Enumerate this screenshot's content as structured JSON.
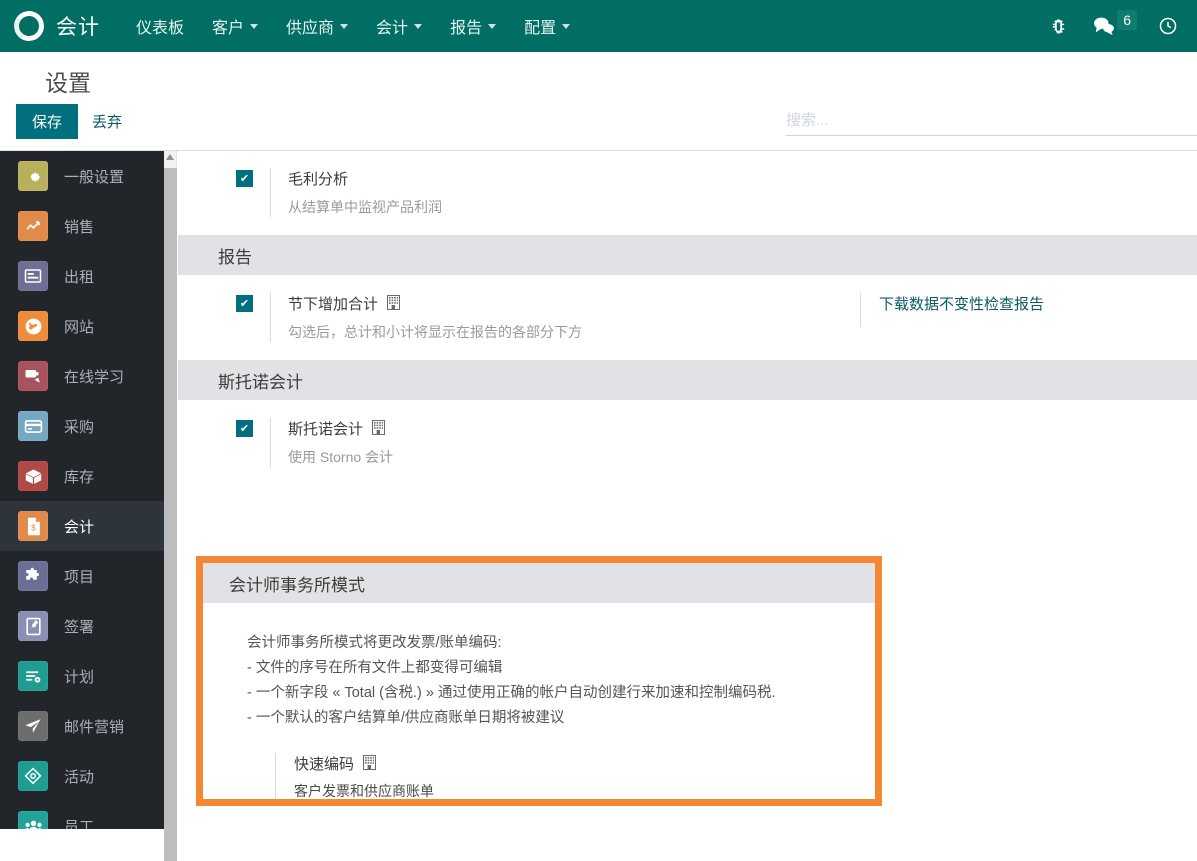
{
  "topbar": {
    "logo_icon": "odoo-o-logo",
    "brand": "会计",
    "menu": [
      {
        "label": "仪表板",
        "has_caret": false
      },
      {
        "label": "客户",
        "has_caret": true
      },
      {
        "label": "供应商",
        "has_caret": true
      },
      {
        "label": "会计",
        "has_caret": true
      },
      {
        "label": "报告",
        "has_caret": true
      },
      {
        "label": "配置",
        "has_caret": true
      }
    ],
    "icons": {
      "debug": "bug-icon",
      "messages": "chat-bubble-icon",
      "messages_count": "6",
      "activity": "clock-icon"
    },
    "background": "#006e62"
  },
  "controlpanel": {
    "title": "设置",
    "save_label": "保存",
    "discard_label": "丢弃",
    "save_color": "#00707f"
  },
  "search": {
    "placeholder": "搜索...",
    "value": ""
  },
  "sidebar": {
    "items": [
      {
        "label": "一般设置",
        "icon": "gear-icon",
        "glyph": "⚙",
        "color": "#b9b05e",
        "active": false
      },
      {
        "label": "销售",
        "icon": "chart-line-icon",
        "glyph": "↗",
        "color": "#e08b4a",
        "active": false
      },
      {
        "label": "出租",
        "icon": "rental-card-icon",
        "glyph": "▤",
        "color": "#6f6f93",
        "active": false
      },
      {
        "label": "网站",
        "icon": "globe-icon",
        "glyph": "ἱ0",
        "color": "#ef8c3a",
        "active": false
      },
      {
        "label": "在线学习",
        "icon": "elearning-icon",
        "glyph": "▶",
        "color": "#a8525c",
        "active": false
      },
      {
        "label": "采购",
        "icon": "credit-card-icon",
        "glyph": "▭",
        "color": "#76a8c2",
        "active": false
      },
      {
        "label": "库存",
        "icon": "box-icon",
        "glyph": "▦",
        "color": "#b04a46",
        "active": false
      },
      {
        "label": "会计",
        "icon": "invoice-icon",
        "glyph": "$",
        "color": "#e08b4a",
        "active": true
      },
      {
        "label": "项目",
        "icon": "puzzle-icon",
        "glyph": "❖",
        "color": "#6b6f96",
        "active": false
      },
      {
        "label": "签署",
        "icon": "signature-icon",
        "glyph": "✎",
        "color": "#8b8fb3",
        "active": false
      },
      {
        "label": "计划",
        "icon": "planning-icon",
        "glyph": "☰",
        "color": "#1f9d92",
        "active": false
      },
      {
        "label": "邮件营销",
        "icon": "paper-plane-icon",
        "glyph": "➤",
        "color": "#6d6d6d",
        "active": false
      },
      {
        "label": "活动",
        "icon": "events-icon",
        "glyph": "◇",
        "color": "#1f9d92",
        "active": false
      },
      {
        "label": "员工",
        "icon": "people-icon",
        "glyph": "⛭",
        "color": "#22a39a",
        "active": false
      }
    ]
  },
  "content": {
    "profit_row": {
      "checked": true,
      "title": "毛利分析",
      "desc": "从结算单中监视产品利润",
      "building_icon": false
    },
    "reports_section": {
      "heading": "报告",
      "row": {
        "checked": true,
        "title": "节下增加合计",
        "building_icon": true,
        "desc": "勾选后，总计和小计将显示在报告的各部分下方"
      },
      "side_link": "下载数据不变性检查报告"
    },
    "storno_section": {
      "heading": "斯托诺会计",
      "row": {
        "checked": true,
        "title": "斯托诺会计",
        "building_icon": true,
        "desc": "使用 Storno 会计"
      }
    },
    "accountant_section": {
      "heading": "会计师事务所模式",
      "highlight_color": "#f58634",
      "lines": [
        "会计师事务所模式将更改发票/账单编码:",
        "- 文件的序号在所有文件上都变得可编辑",
        "- 一个新字段 « Total (含税.) » 通过使用正确的帐户自动创建行来加速和控制编码税.",
        "- 一个默认的客户结算单/供应商账单日期将被建议"
      ],
      "sub_row": {
        "title": "快速编码",
        "building_icon": true,
        "desc": "客户发票和供应商账单"
      }
    }
  }
}
